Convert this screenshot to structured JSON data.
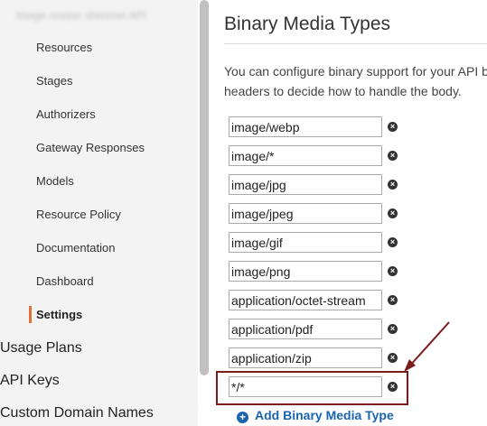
{
  "sidebar": {
    "api_name": "Image resizer shimmer API",
    "items": [
      {
        "label": "Resources"
      },
      {
        "label": "Stages"
      },
      {
        "label": "Authorizers"
      },
      {
        "label": "Gateway Responses"
      },
      {
        "label": "Models"
      },
      {
        "label": "Resource Policy"
      },
      {
        "label": "Documentation"
      },
      {
        "label": "Dashboard"
      },
      {
        "label": "Settings",
        "active": true
      }
    ],
    "top_items": [
      {
        "label": "Usage Plans"
      },
      {
        "label": "API Keys"
      },
      {
        "label": "Custom Domain Names"
      }
    ]
  },
  "main": {
    "title": "Binary Media Types",
    "description_line1": "You can configure binary support for your API b",
    "description_line2": "headers to decide how to handle the body.",
    "media_types": [
      "image/webp",
      "image/*",
      "image/jpg",
      "image/jpeg",
      "image/gif",
      "image/png",
      "application/octet-stream",
      "application/pdf",
      "application/zip",
      "*/*"
    ],
    "remove_icon": "close-circle-icon",
    "add_label": "Add Binary Media Type",
    "add_icon": "plus-circle-icon"
  },
  "colors": {
    "accent_active": "#e0703a",
    "link": "#1a64b0",
    "annotation": "#7b1c1c"
  }
}
